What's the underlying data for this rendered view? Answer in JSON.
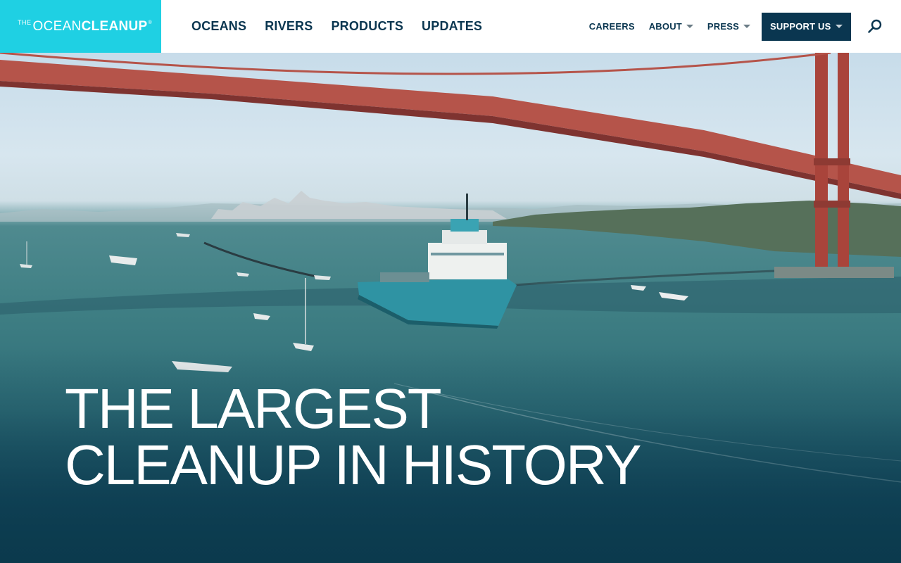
{
  "logo": {
    "the": "THE",
    "ocean": "OCEAN",
    "cleanup": "CLEANUP",
    "mark": "®"
  },
  "main_nav": [
    "OCEANS",
    "RIVERS",
    "PRODUCTS",
    "UPDATES"
  ],
  "secondary_nav": {
    "careers": "CAREERS",
    "about": "ABOUT",
    "press": "PRESS",
    "support": "SUPPORT US"
  },
  "icons": {
    "search": "search-icon",
    "dropdown": "chevron-down-icon"
  },
  "hero": {
    "title_line1": "THE LARGEST",
    "title_line2": "CLEANUP IN HISTORY"
  },
  "colors": {
    "logo_bg": "#1fd0e3",
    "nav_text": "#0a3650",
    "support_bg": "#0a3650",
    "bridge": "#b5544a"
  }
}
